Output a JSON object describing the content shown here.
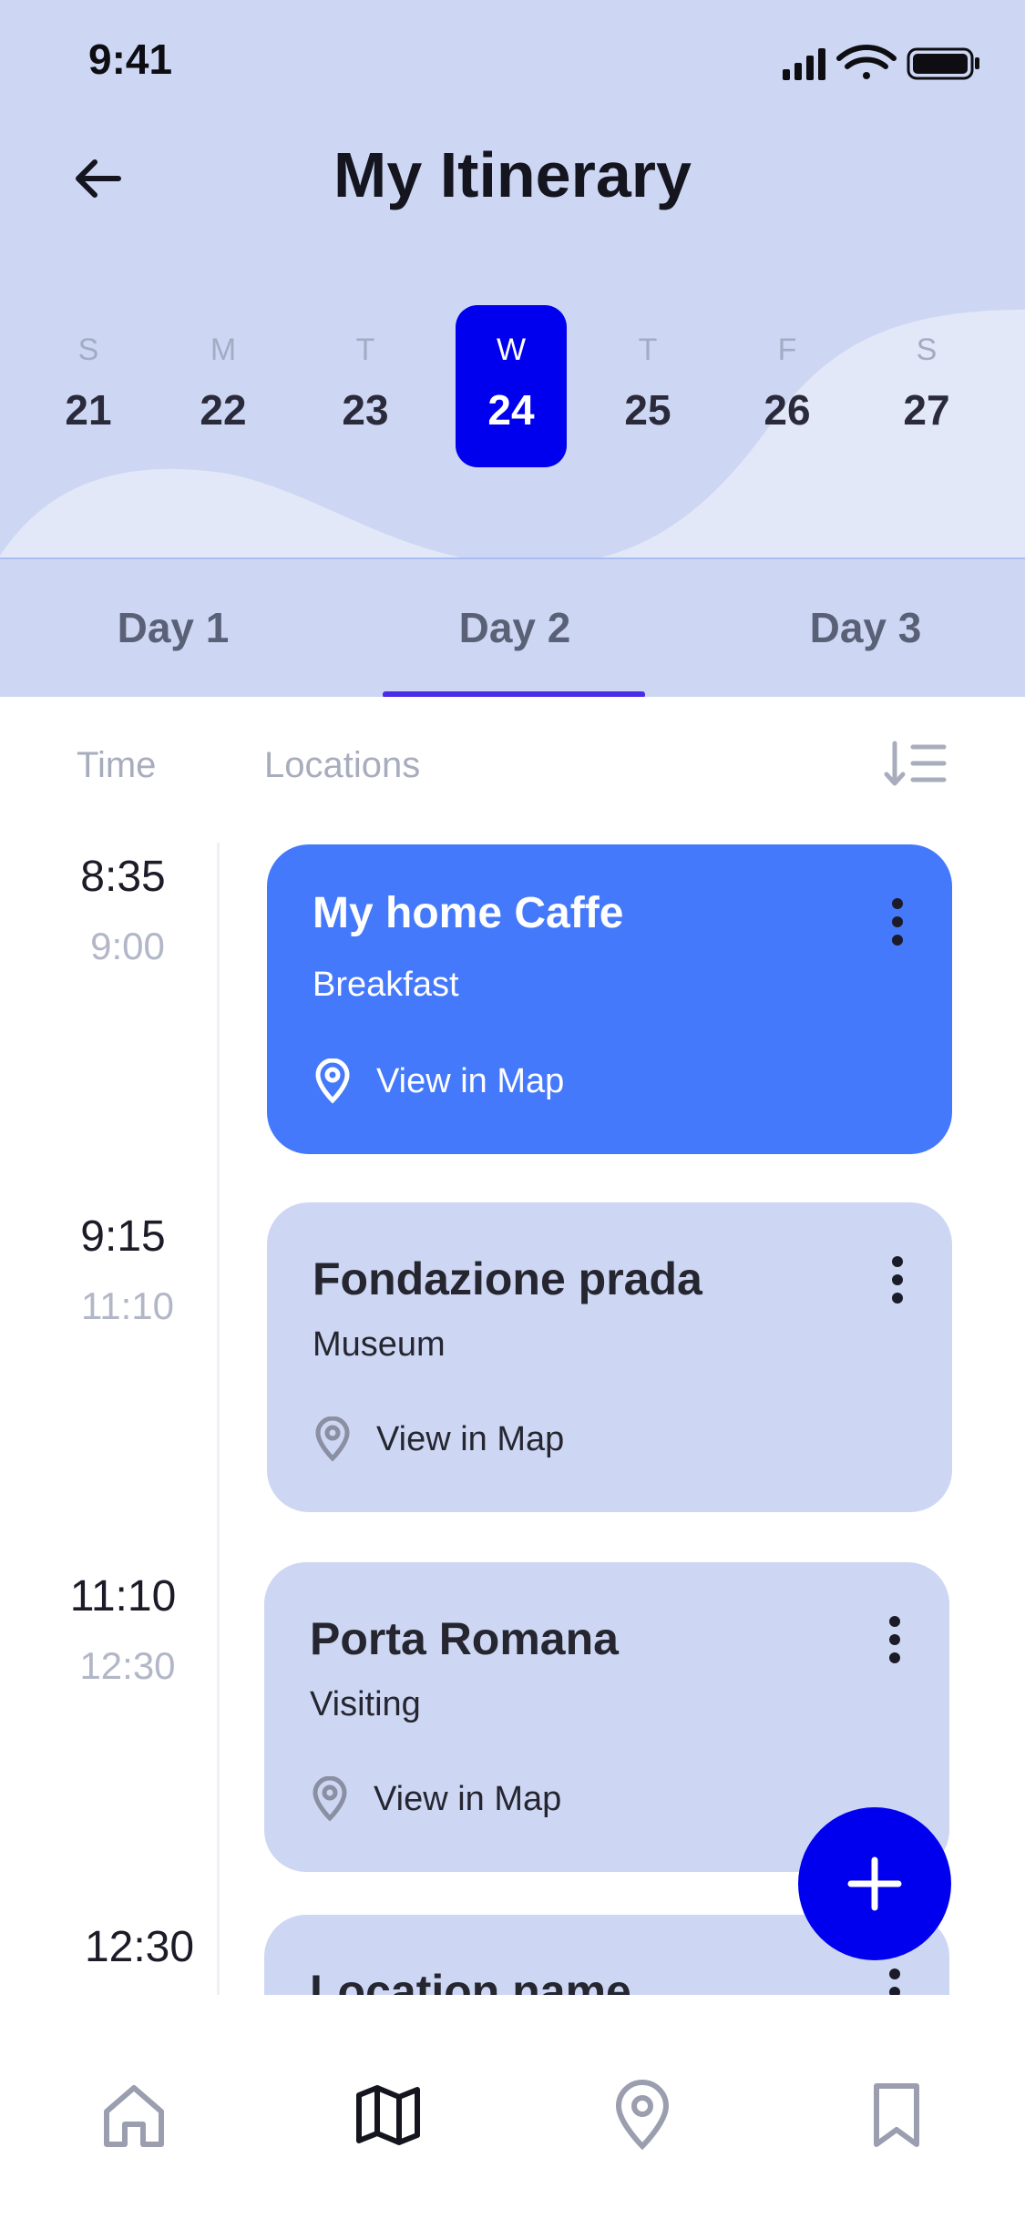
{
  "status": {
    "time": "9:41"
  },
  "header": {
    "title": "My Itinerary"
  },
  "week": [
    {
      "dow": "S",
      "num": "21"
    },
    {
      "dow": "M",
      "num": "22"
    },
    {
      "dow": "T",
      "num": "23"
    },
    {
      "dow": "W",
      "num": "24",
      "active": true
    },
    {
      "dow": "T",
      "num": "25"
    },
    {
      "dow": "F",
      "num": "26"
    },
    {
      "dow": "S",
      "num": "27"
    }
  ],
  "tabs": [
    "Day 1",
    "Day 2",
    "Day 3"
  ],
  "active_tab": "Day 2",
  "list_header": {
    "time": "Time",
    "locations": "Locations"
  },
  "items": [
    {
      "start": "8:35",
      "end": "9:00",
      "title": "My home Caffe",
      "subtitle": "Breakfast",
      "map_label": "View in Map"
    },
    {
      "start": "9:15",
      "end": "11:10",
      "title": "Fondazione prada",
      "subtitle": "Museum",
      "map_label": "View in Map"
    },
    {
      "start": "11:10",
      "end": "12:30",
      "title": "Porta Romana",
      "subtitle": "Visiting",
      "map_label": "View in Map"
    },
    {
      "start": "12:30",
      "end": "",
      "title": "Location name",
      "subtitle": "",
      "map_label": ""
    }
  ],
  "colors": {
    "accent": "#0000ee",
    "card_primary": "#4579fb",
    "card": "#cdd7f4",
    "tab_indicator": "#4a2ce6"
  },
  "bottom_nav": [
    "home-icon",
    "map-icon",
    "location-pin-icon",
    "bookmark-icon"
  ]
}
